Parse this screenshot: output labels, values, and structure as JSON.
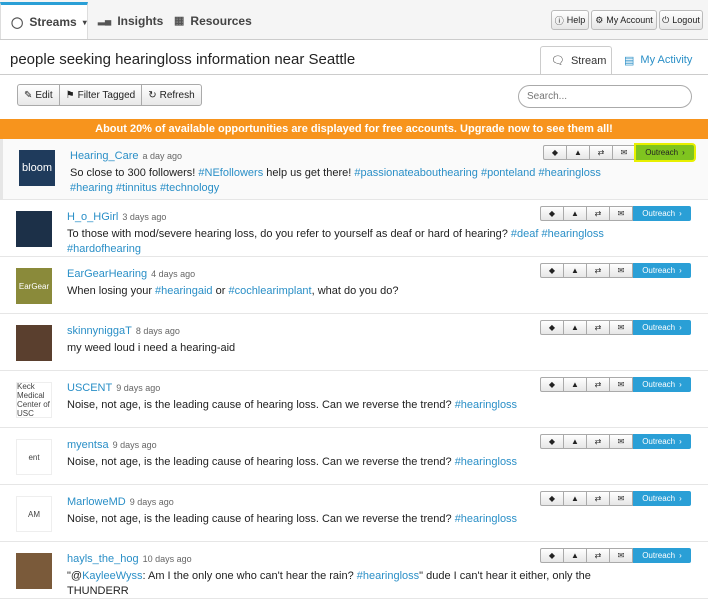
{
  "nav": {
    "tabs": [
      {
        "label": "Streams",
        "icon": "streams-icon"
      },
      {
        "label": "Insights",
        "icon": "bar-chart-icon"
      },
      {
        "label": "Resources",
        "icon": "grid-icon"
      }
    ],
    "buttons": [
      {
        "label": "Help",
        "icon": "info-icon"
      },
      {
        "label": "My Account",
        "icon": "gear-icon"
      },
      {
        "label": "Logout",
        "icon": "power-icon"
      }
    ]
  },
  "stream": {
    "title": "people seeking hearingloss information near Seattle",
    "view_tabs": [
      "Stream",
      "My Activity"
    ]
  },
  "toolbar": {
    "edit": "Edit",
    "filter_tagged": "Filter Tagged",
    "refresh": "Refresh",
    "search_placeholder": "Search..."
  },
  "banner": "About 20% of available opportunities are displayed for free accounts. Upgrade now to see them all!",
  "outreach_label": "Outreach",
  "colors": {
    "accent": "#2a9fd6",
    "banner": "#f7941d",
    "highlight": "#7fc41f"
  },
  "posts": [
    {
      "user": "Hearing_Care",
      "ago": "a day ago",
      "avatar_text": "bloom",
      "avatar_color": "#1f3b5c",
      "line1": [
        {
          "t": "So close to 300 followers! "
        },
        {
          "t": "#NEfollowers",
          "tag": true
        },
        {
          "t": " help us get there! "
        },
        {
          "t": "#passionateabouthearing",
          "tag": true
        },
        {
          "t": " "
        },
        {
          "t": "#ponteland",
          "tag": true
        },
        {
          "t": " "
        },
        {
          "t": "#hearingloss",
          "tag": true
        }
      ],
      "line2": [
        {
          "t": "#hearing",
          "tag": true
        },
        {
          "t": " "
        },
        {
          "t": "#tinnitus",
          "tag": true
        },
        {
          "t": " "
        },
        {
          "t": "#technology",
          "tag": true
        }
      ]
    },
    {
      "user": "H_o_HGirl",
      "ago": "3 days ago",
      "avatar_text": "",
      "avatar_color": "#1c3048",
      "line1": [
        {
          "t": "To those with mod/severe hearing loss, do you refer to yourself as deaf or hard of hearing? "
        },
        {
          "t": "#deaf",
          "tag": true
        },
        {
          "t": " "
        },
        {
          "t": "#hearingloss",
          "tag": true
        }
      ],
      "line2": [
        {
          "t": "#hardofhearing",
          "tag": true
        }
      ]
    },
    {
      "user": "EarGearHearing",
      "ago": "4 days ago",
      "avatar_text": "EarGear",
      "avatar_color": "#8a8a3a",
      "line1": [
        {
          "t": "When losing your "
        },
        {
          "t": "#hearingaid",
          "tag": true
        },
        {
          "t": " or "
        },
        {
          "t": "#cochlearimplant",
          "tag": true
        },
        {
          "t": ", what do you do?"
        }
      ],
      "line2": []
    },
    {
      "user": "skinnyniggaT",
      "ago": "8 days ago",
      "avatar_text": "",
      "avatar_color": "#5a3f2e",
      "line1": [
        {
          "t": "my weed loud i need a hearing-aid"
        }
      ],
      "line2": []
    },
    {
      "user": "USCENT",
      "ago": "9 days ago",
      "avatar_text": "Keck Medical Center of USC",
      "avatar_color": "#ffffff",
      "line1": [
        {
          "t": "Noise, not age, is the leading cause of hearing loss. Can we reverse the trend? "
        },
        {
          "t": "#hearingloss",
          "tag": true
        }
      ],
      "line2": []
    },
    {
      "user": "myentsa",
      "ago": "9 days ago",
      "avatar_text": "ent",
      "avatar_color": "#ffffff",
      "line1": [
        {
          "t": "Noise, not age, is the leading cause of hearing loss. Can we reverse the trend? "
        },
        {
          "t": "#hearingloss",
          "tag": true
        }
      ],
      "line2": []
    },
    {
      "user": "MarloweMD",
      "ago": "9 days ago",
      "avatar_text": "AM",
      "avatar_color": "#ffffff",
      "line1": [
        {
          "t": "Noise, not age, is the leading cause of hearing loss. Can we reverse the trend? "
        },
        {
          "t": "#hearingloss",
          "tag": true
        }
      ],
      "line2": []
    },
    {
      "user": "hayls_the_hog",
      "ago": "10 days ago",
      "avatar_text": "",
      "avatar_color": "#7a5a3a",
      "line1": [
        {
          "t": "\"@"
        },
        {
          "t": "KayleeWyss",
          "tag": true
        },
        {
          "t": ": Am I the only one who can't hear the rain? "
        },
        {
          "t": "#hearingloss",
          "tag": true
        },
        {
          "t": "\" dude I can't hear it either, only the"
        }
      ],
      "line2": [
        {
          "t": "THUNDERR"
        }
      ]
    }
  ]
}
